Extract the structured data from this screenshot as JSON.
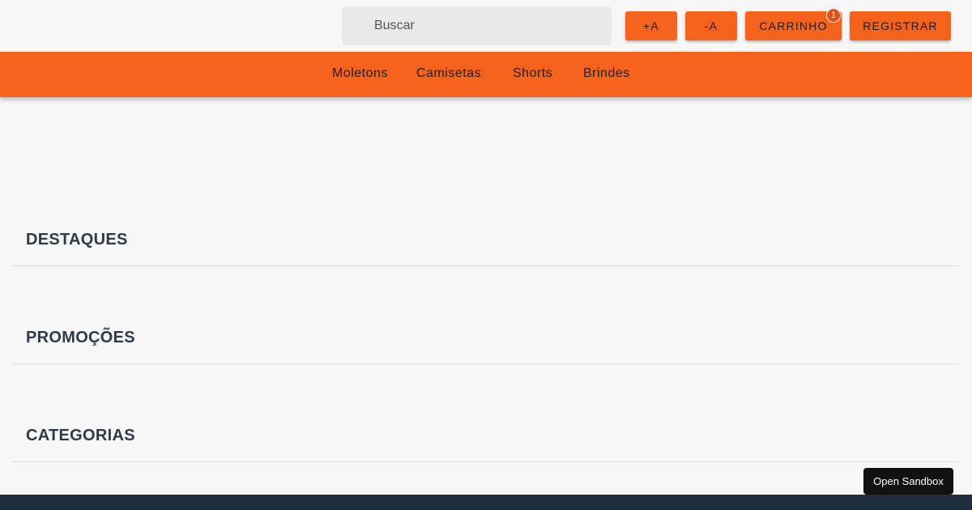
{
  "header": {
    "search_placeholder": "Buscar",
    "font_increase_label": "+A",
    "font_decrease_label": "-A",
    "cart_label": "CARRINHO",
    "cart_count": "1",
    "register_label": "REGISTRAR"
  },
  "nav": {
    "items": [
      "Moletons",
      "Camisetas",
      "Shorts",
      "Brindes"
    ]
  },
  "sections": [
    {
      "title": "DESTAQUES"
    },
    {
      "title": "PROMOÇÕES"
    },
    {
      "title": "CATEGORIAS"
    }
  ],
  "sandbox_button": "Open Sandbox",
  "colors": {
    "accent": "#f5621c",
    "background": "#f7f7f7",
    "footer": "#1f2d3d"
  }
}
